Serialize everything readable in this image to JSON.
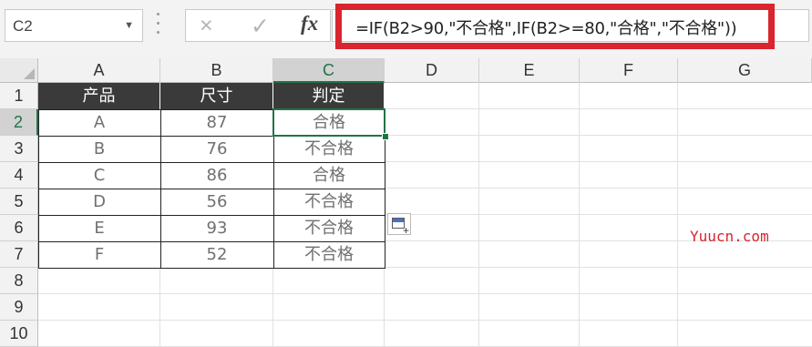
{
  "name_box": {
    "value": "C2"
  },
  "formula_bar": {
    "cancel_icon": "×",
    "enter_icon": "✓",
    "fx_label": "fx",
    "formula": "=IF(B2>90,\"不合格\",IF(B2>=80,\"合格\",\"不合格\"))"
  },
  "columns": [
    "A",
    "B",
    "C",
    "D",
    "E",
    "F",
    "G"
  ],
  "rows": [
    "1",
    "2",
    "3",
    "4",
    "5",
    "6",
    "7",
    "8",
    "9",
    "10"
  ],
  "table": {
    "headers": [
      "产品",
      "尺寸",
      "判定"
    ],
    "rows": [
      [
        "A",
        "87",
        "合格"
      ],
      [
        "B",
        "76",
        "不合格"
      ],
      [
        "C",
        "86",
        "合格"
      ],
      [
        "D",
        "56",
        "不合格"
      ],
      [
        "E",
        "93",
        "不合格"
      ],
      [
        "F",
        "52",
        "不合格"
      ]
    ]
  },
  "selected_cell": "C2",
  "accent_colors": {
    "excel_green": "#217346",
    "highlight_red": "#d9252d",
    "header_fill": "#3a3a3a"
  },
  "watermark": "Yuucn.com"
}
